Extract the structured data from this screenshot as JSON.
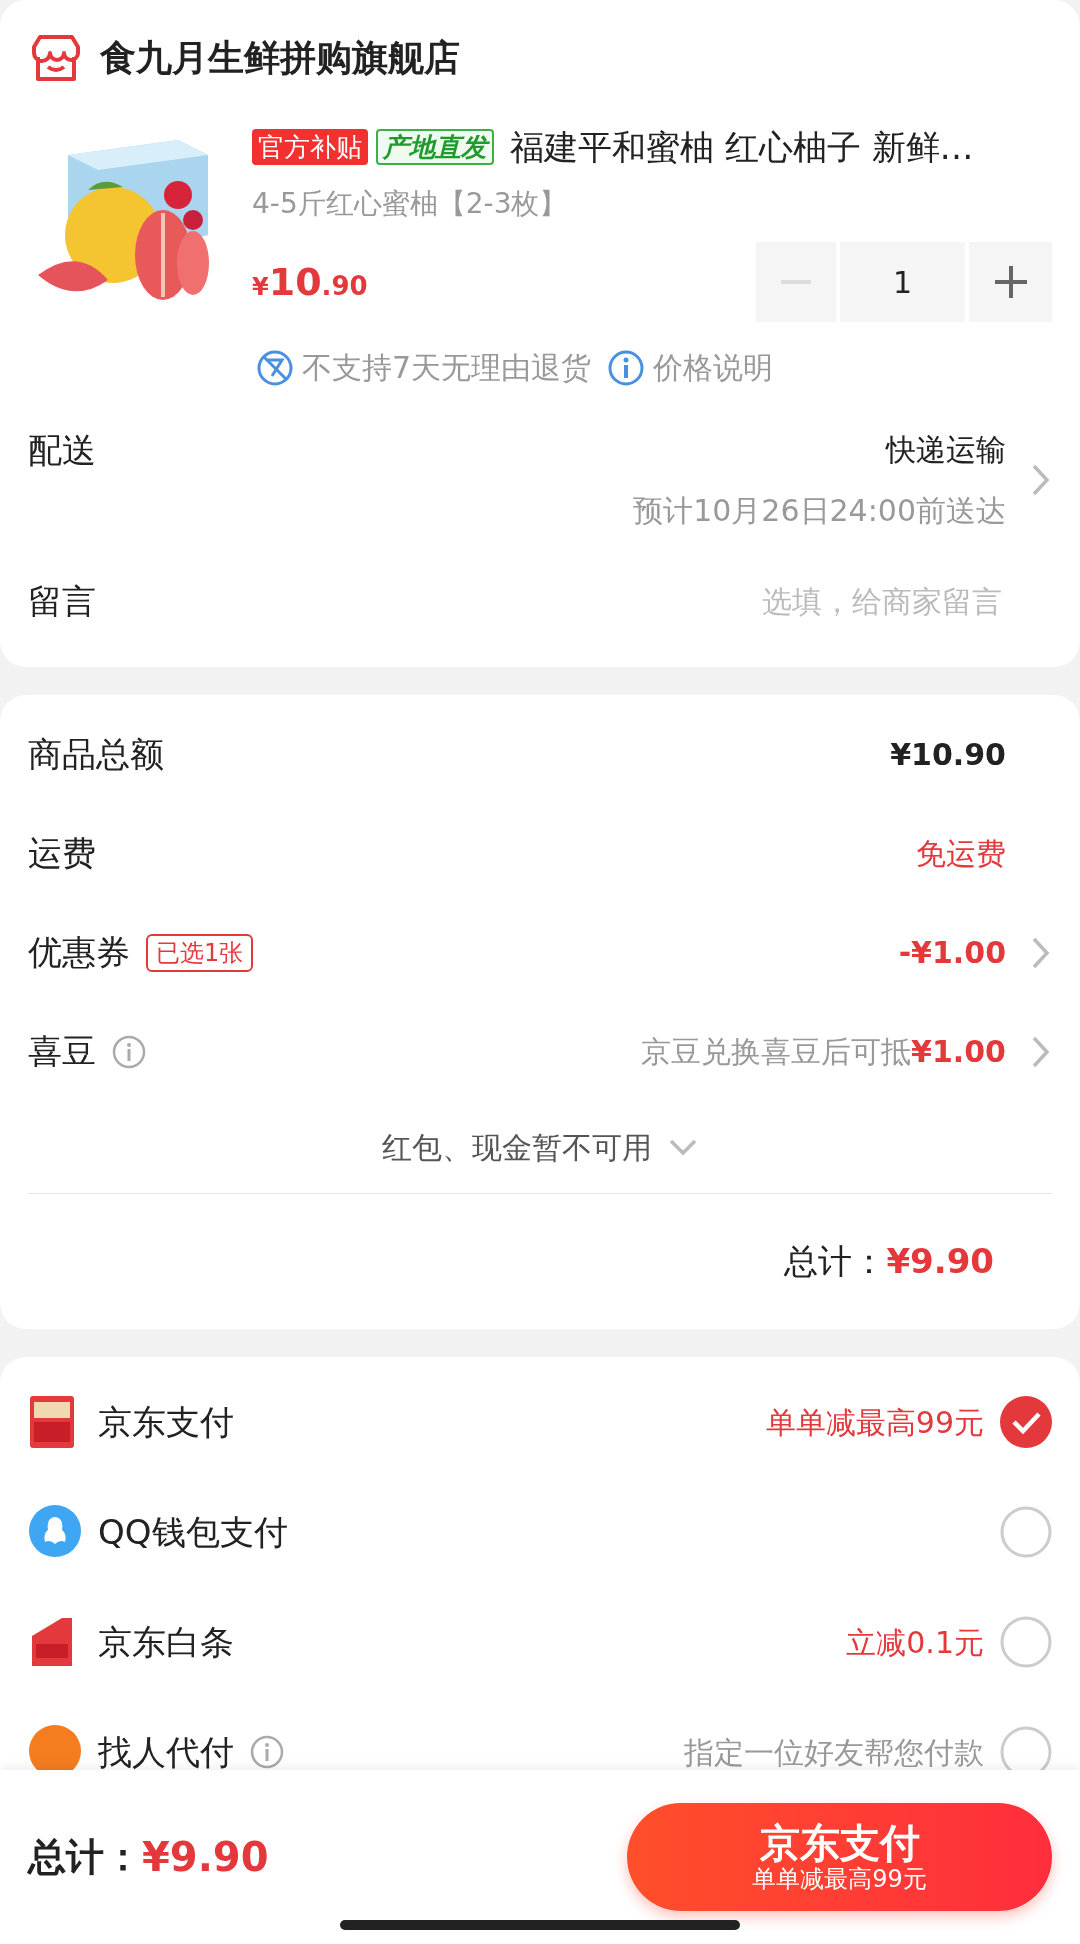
{
  "store": {
    "name": "食九月生鲜拼购旗舰店"
  },
  "product": {
    "kind": "picture",
    "tags": [
      {
        "text": "官方补贴",
        "kind": "solid"
      },
      {
        "text": "产地直发",
        "kind": "outline"
      }
    ],
    "title": "福建平和蜜柚 红心柚子 新鲜…",
    "sku": "4-5斤红心蜜柚【2-3枚】",
    "price_symbol": "¥",
    "price_int": "10",
    "price_dec": ".90",
    "quantity": "1",
    "minus_disabled": true,
    "notices": [
      {
        "kind": "no-return",
        "text": "不支持7天无理由退货"
      },
      {
        "kind": "info",
        "text": "价格说明"
      }
    ]
  },
  "delivery": {
    "label": "配送",
    "method": "快递运输",
    "eta": "预计10月26日24:00前送达"
  },
  "message": {
    "label": "留言",
    "placeholder": "选填，给商家留言"
  },
  "summary": {
    "rows": [
      {
        "label": "商品总额",
        "value": "¥10.90",
        "color": "#222222",
        "chevron": false
      },
      {
        "label": "运费",
        "value": "免运费",
        "color": "#e4393c",
        "chevron": false
      },
      {
        "label": "优惠券",
        "badge": "已选1张",
        "value": "-¥1.00",
        "color": "#e4393c",
        "chevron": true
      },
      {
        "label": "喜豆",
        "info": true,
        "note": "京豆兑换喜豆后可抵",
        "value": "¥1.00",
        "color": "#e4393c",
        "chevron": true
      }
    ],
    "toggle": "红包、现金暂不可用",
    "total_label": "总计：",
    "total_value": "¥9.90"
  },
  "payments": [
    {
      "name": "京东支付",
      "promo": "单单减最高99元",
      "selected": true
    },
    {
      "name": "QQ钱包支付",
      "selected": false
    },
    {
      "name": "京东白条",
      "promo": "立减0.1元",
      "selected": false
    },
    {
      "name": "找人代付",
      "info": true,
      "hint": "指定一位好友帮您付款",
      "selected": false
    }
  ],
  "footer": {
    "total_label": "总计：",
    "total_value": "¥9.90",
    "button_title": "京东支付",
    "button_subtitle": "单单减最高99元"
  }
}
